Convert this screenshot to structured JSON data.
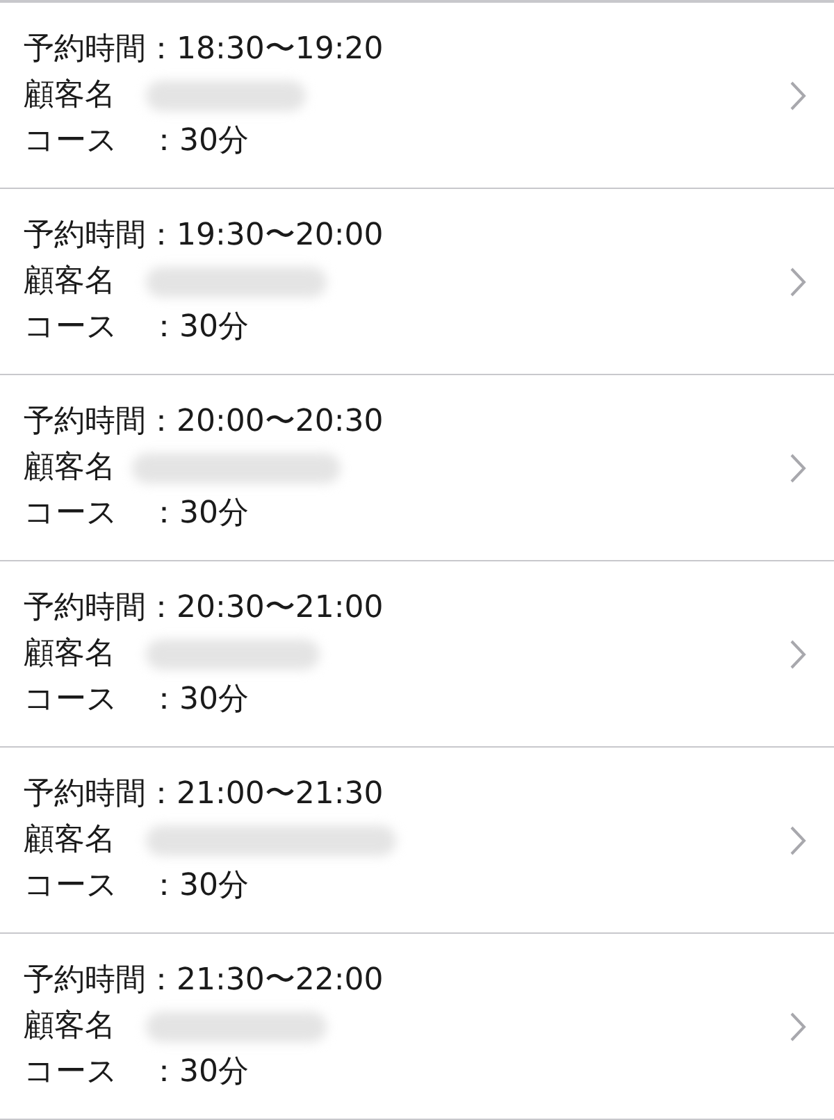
{
  "reservations": [
    {
      "time": "予約時間：18:30〜19:20",
      "name_label": "顧客名",
      "course": "コース　：30分"
    },
    {
      "time": "予約時間：19:30〜20:00",
      "name_label": "顧客名",
      "course": "コース　：30分"
    },
    {
      "time": "予約時間：20:00〜20:30",
      "name_label": "顧客名",
      "course": "コース　：30分"
    },
    {
      "time": "予約時間：20:30〜21:00",
      "name_label": "顧客名",
      "course": "コース　：30分"
    },
    {
      "time": "予約時間：21:00〜21:30",
      "name_label": "顧客名",
      "course": "コース　：30分"
    },
    {
      "time": "予約時間：21:30〜22:00",
      "name_label": "顧客名",
      "course": "コース　：30分"
    }
  ]
}
